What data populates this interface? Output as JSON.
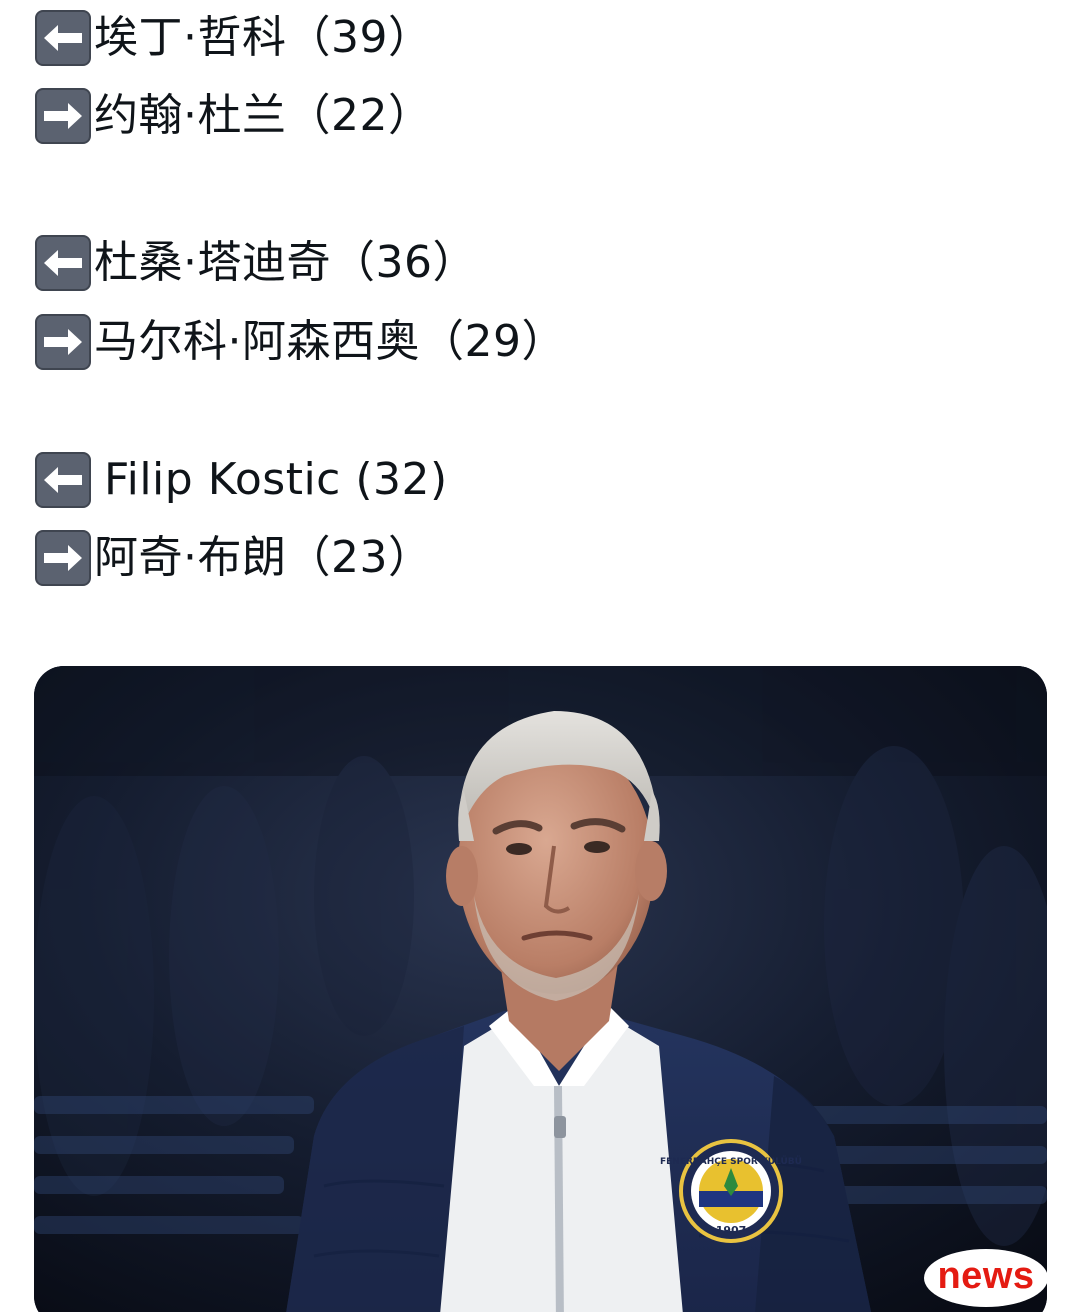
{
  "lines": [
    {
      "direction": "left",
      "icon": "left-arrow-icon",
      "text": "埃丁·哲科（39）"
    },
    {
      "direction": "right",
      "icon": "right-arrow-icon",
      "text": "约翰·杜兰（22）"
    },
    {
      "direction": "left",
      "icon": "left-arrow-icon",
      "text": "杜桑·塔迪奇（36）"
    },
    {
      "direction": "right",
      "icon": "right-arrow-icon",
      "text": "马尔科·阿森西奥（29）"
    },
    {
      "direction": "left",
      "icon": "left-arrow-icon",
      "text": "Filip Kostic (32)"
    },
    {
      "direction": "right",
      "icon": "right-arrow-icon",
      "text": "阿奇·布朗（23）"
    }
  ],
  "photo": {
    "crest_text": "FENERBAHÇE SPOR KULÜBÜ",
    "crest_year": "1907"
  },
  "watermark": {
    "text": "news",
    "color": "#e41b12"
  },
  "colors": {
    "text": "#0f1419",
    "emoji_bg": "#5b6270"
  }
}
